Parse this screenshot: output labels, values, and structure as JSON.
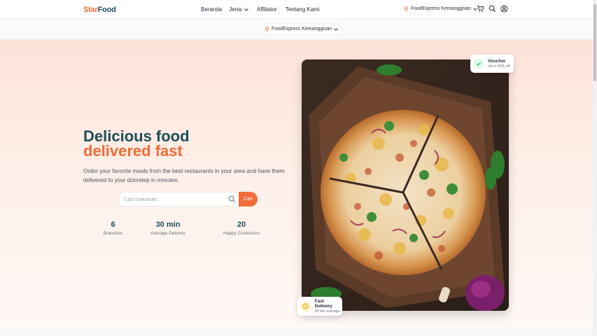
{
  "header": {
    "logo_part1": "Star",
    "logo_part2": "Food",
    "nav": [
      "Beranda",
      "Jenis",
      "Affiliator",
      "Tentang Kami"
    ],
    "location": "FoodExpress Kemanggisan",
    "icons": [
      "cart-icon",
      "search-icon",
      "user-icon"
    ]
  },
  "subbar": {
    "location": "FoodExpress Kemanggisan"
  },
  "hero": {
    "title_line1": "Delicious food",
    "title_line2": "delivered fast",
    "description": "Order your favorite meals from the best restaurants in your area and have them delivered to your doorstep in minutes.",
    "search_placeholder": "Cari makanan...",
    "search_button": "Cari",
    "stats": [
      {
        "value": "6",
        "label": "Branches"
      },
      {
        "value": "30 min",
        "label": "Average Delivery"
      },
      {
        "value": "20",
        "label": "Happy Customers"
      }
    ]
  },
  "voucher_card": {
    "title": "Voucher",
    "subtitle": "Up to 50% off"
  },
  "delivery_card": {
    "title": "Fast Delivery",
    "subtitle": "30 min average"
  },
  "colors": {
    "brand_orange": "#f26b38",
    "brand_teal": "#1f4e5a",
    "success_green": "#22c55e",
    "amber": "#f59e0b"
  }
}
